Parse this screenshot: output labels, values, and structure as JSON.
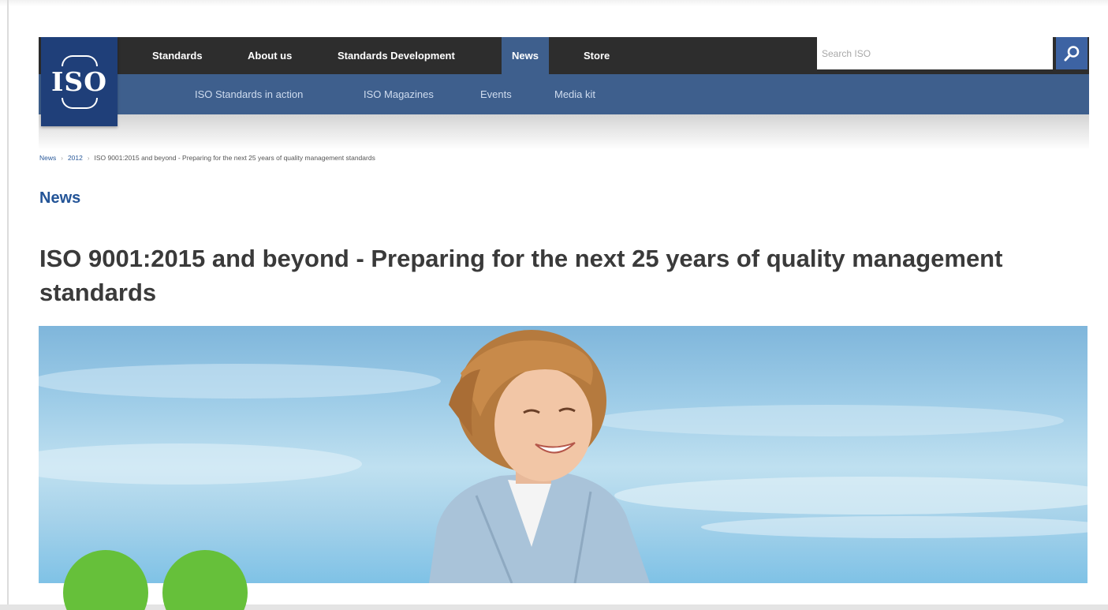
{
  "nav": {
    "logo_text": "ISO",
    "items": [
      {
        "label": "Standards"
      },
      {
        "label": "About us"
      },
      {
        "label": "Standards Development"
      },
      {
        "label": "News"
      },
      {
        "label": "Store"
      }
    ],
    "active_item": "News",
    "sub_items": [
      {
        "label": "ISO Standards in action"
      },
      {
        "label": "ISO Magazines"
      },
      {
        "label": "Events"
      },
      {
        "label": "Media kit"
      }
    ],
    "search_placeholder": "Search ISO",
    "search_icon": "search-icon"
  },
  "breadcrumb": {
    "items": [
      "News",
      "2012",
      "ISO 9001:2015 and beyond - Preparing for the next 25 years of quality management standards"
    ],
    "separator": "›"
  },
  "section_label": "News",
  "article": {
    "title": "ISO 9001:2015 and beyond - Preparing for the next 25 years of quality management standards"
  },
  "colors": {
    "nav_dark": "#2d2d2d",
    "nav_blue": "#3e5f8d",
    "logo_blue": "#1f3f79",
    "link_blue": "#235497",
    "accent_green": "#66c03a"
  }
}
